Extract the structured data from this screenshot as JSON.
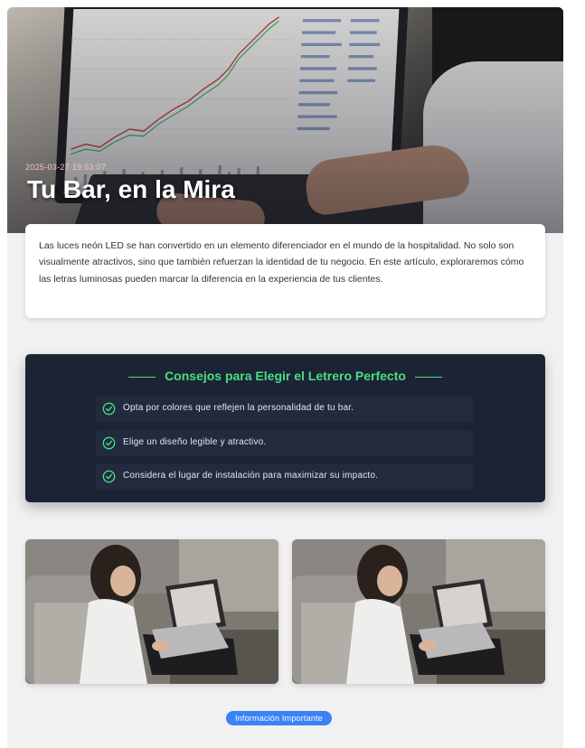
{
  "hero": {
    "date": "2025-03-27 19:53:07",
    "title": "Tu Bar, en la Mira",
    "image": "laptop-trading-chart-photo"
  },
  "intro": {
    "text": "Las luces neón LED se han convertido en un elemento diferenciador en el mundo de la hospitalidad. No solo son visualmente atractivos, sino que también refuerzan la identidad de tu negocio. En este artículo, exploraremos cómo las letras luminosas pueden marcar la diferencia en la experiencia de tus clientes."
  },
  "tips": {
    "heading": "Consejos para Elegir el Letrero Perfecto",
    "items": [
      {
        "text": "Opta por colores que reflejen la personalidad de tu bar.",
        "icon": "check-circle-icon"
      },
      {
        "text": "Elige un diseño legible y atractivo.",
        "icon": "check-circle-icon"
      },
      {
        "text": "Considera el lugar de instalación para maximizar su impacto.",
        "icon": "check-circle-icon"
      }
    ],
    "accent": "#4ade80",
    "background": "#1c2335"
  },
  "gallery": {
    "images": [
      "woman-laptop-sofa-photo",
      "woman-laptop-sofa-photo"
    ]
  },
  "badge": {
    "label": "Información Importante",
    "color": "#3b82f6"
  }
}
